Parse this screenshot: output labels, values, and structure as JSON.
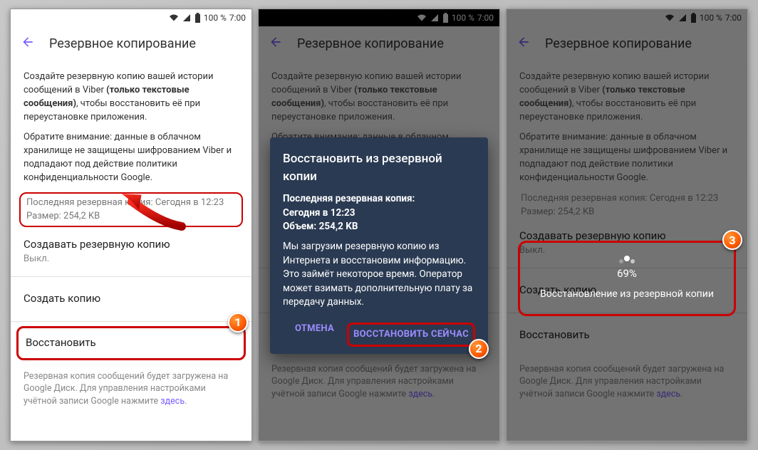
{
  "status": {
    "battery": "100 %",
    "time": "7:00"
  },
  "app_bar": {
    "title": "Резервное копирование"
  },
  "intro": {
    "line1_a": "Создайте резервную копию вашей истории сообщений в Viber ",
    "line1_b": "(только текстовые сообщения)",
    "line1_c": ", чтобы восстановить её при переустановке приложения.",
    "line2": "Обратите внимание: данные в облачном хранилище не защищены шифрованием Viber и подпадают под действие политики конфиденциальности Google."
  },
  "backup_info": {
    "last": "Последняя резервная копия: Сегодня в 12:23",
    "size": "Размер: 254,2 KB"
  },
  "auto_backup": {
    "title": "Создавать резервную копию",
    "value": "Выкл."
  },
  "actions": {
    "create": "Создать копию",
    "restore": "Восстановить"
  },
  "footer": {
    "text_a": "Резервная копия сообщений будет загружена на Google Диск. Для управления настройками учётной записи Google нажмите ",
    "link": "здесь",
    "dot": "."
  },
  "dialog": {
    "title": "Восстановить из резервной копии",
    "last_label": "Последняя резервная копия:",
    "last_value": "Сегодня в 12:23",
    "size_label": "Объем:",
    "size_value": "254,2 KB",
    "body": "Мы загрузим резервную копию из Интернета и восстановим информацию.\nЭто займёт некоторое время. Оператор может взимать дополнительную плату за передачу данных.",
    "cancel": "ОТМЕНА",
    "confirm": "ВОССТАНОВИТЬ СЕЙЧАС"
  },
  "progress": {
    "percent": "69%",
    "label": "Восстановление из резервной копии"
  },
  "badges": {
    "b1": "1",
    "b2": "2",
    "b3": "3"
  }
}
